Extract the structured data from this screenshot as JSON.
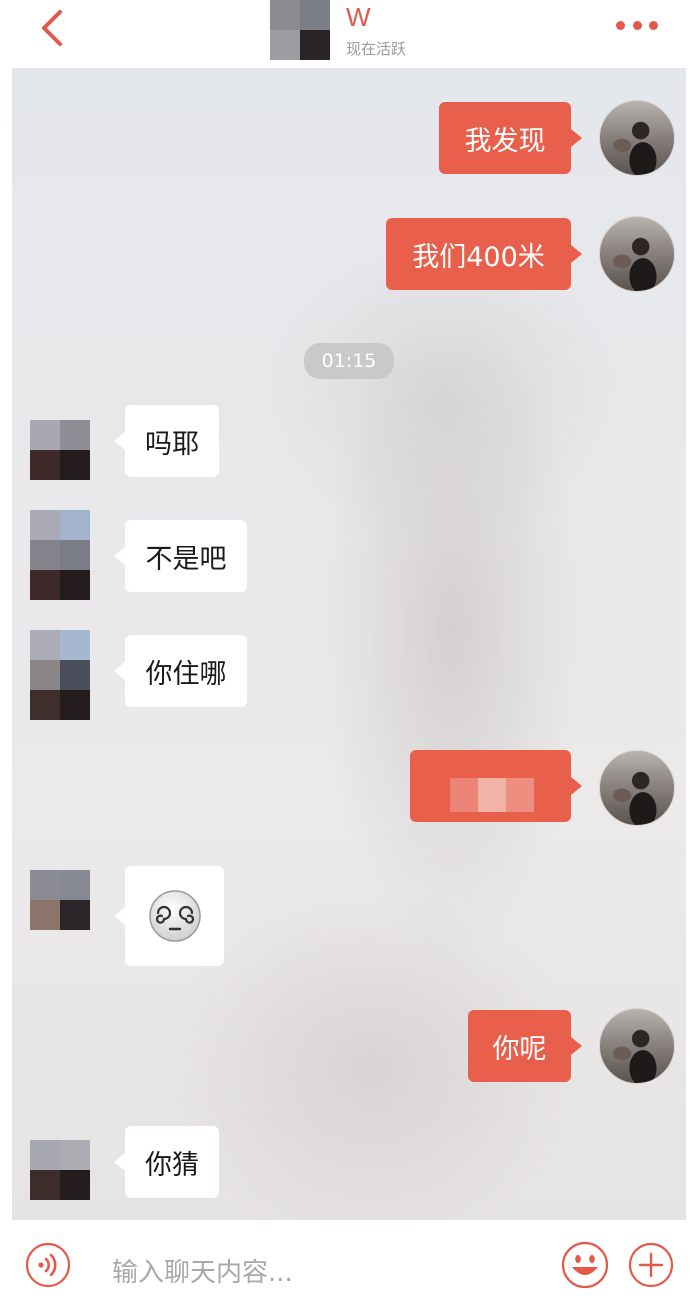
{
  "header": {
    "name": "W",
    "status": "现在活跃",
    "accent_color": "#e4584a",
    "back_icon": "chevron-left-icon",
    "more_icon": "more-dots-icon"
  },
  "messages": [
    {
      "side": "out",
      "text": "我发现"
    },
    {
      "side": "out",
      "text": "我们400米"
    },
    {
      "type": "time",
      "text": "01:15"
    },
    {
      "side": "in",
      "text": "吗耶"
    },
    {
      "side": "in",
      "text": "不是吧"
    },
    {
      "side": "in",
      "text": "你住哪"
    },
    {
      "side": "out",
      "text": ""
    },
    {
      "side": "in",
      "text": "",
      "emoji": "dizzy-face-emoji"
    },
    {
      "side": "out",
      "text": "你呢"
    },
    {
      "side": "in",
      "text": "你猜"
    }
  ],
  "input": {
    "placeholder": "输入聊天内容...",
    "voice_icon": "voice-icon",
    "emoji_icon": "smiley-icon",
    "plus_icon": "plus-icon"
  },
  "colors": {
    "outgoing_bubble": "#e8604c",
    "incoming_bubble": "#ffffff",
    "time_pill": "#c9c8cb"
  }
}
